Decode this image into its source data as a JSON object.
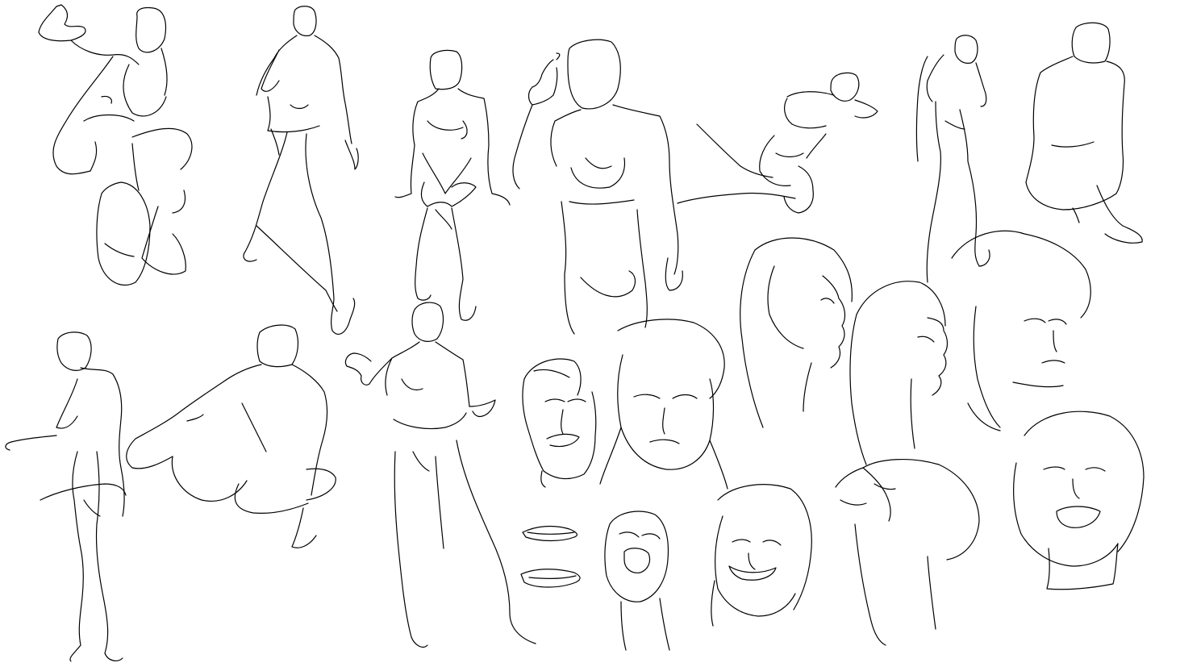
{
  "canvas": {
    "background_color": "#ffffff",
    "stroke_color": "#000000",
    "description_visible_text": ""
  },
  "sketches": [
    {
      "kind": "figure",
      "subject": "crouching-figure-leg-raised"
    },
    {
      "kind": "figure",
      "subject": "standing-figure-from-behind"
    },
    {
      "kind": "figure",
      "subject": "seated-female-figure"
    },
    {
      "kind": "figure",
      "subject": "female-torso-pointing-up"
    },
    {
      "kind": "figure",
      "subject": "reclining-figure"
    },
    {
      "kind": "figure",
      "subject": "leaning-standing-figure"
    },
    {
      "kind": "figure",
      "subject": "seated-figure-from-behind"
    },
    {
      "kind": "figure",
      "subject": "standing-figure-side-view"
    },
    {
      "kind": "figure",
      "subject": "kneeling-figure-from-behind"
    },
    {
      "kind": "figure",
      "subject": "standing-female-figure-gesturing"
    },
    {
      "kind": "head",
      "subject": "man-with-moustache"
    },
    {
      "kind": "head",
      "subject": "woman-frowning-with-hat"
    },
    {
      "kind": "head",
      "subject": "woman-profile-long-hair"
    },
    {
      "kind": "head",
      "subject": "woman-profile-eyes-closed"
    },
    {
      "kind": "head",
      "subject": "curly-hair-face"
    },
    {
      "kind": "study",
      "subject": "mouth-studies"
    },
    {
      "kind": "head",
      "subject": "man-shouting"
    },
    {
      "kind": "head",
      "subject": "woman-smiling-eyes-closed"
    },
    {
      "kind": "head",
      "subject": "head-tilted-back"
    },
    {
      "kind": "head",
      "subject": "laughing-face"
    }
  ]
}
